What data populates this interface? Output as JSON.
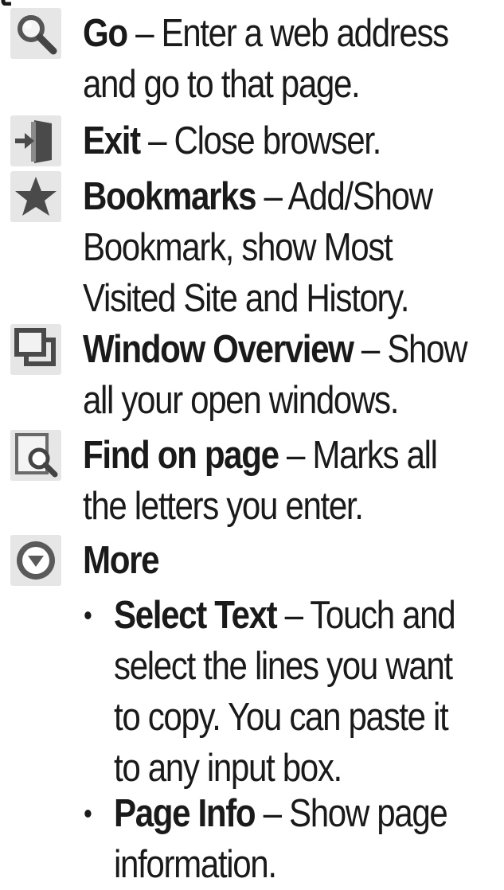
{
  "items": [
    {
      "icon": "search-icon",
      "title": "Go",
      "lines": [
        "– Enter a web address",
        "and go to that page."
      ]
    },
    {
      "icon": "exit-door-icon",
      "title": "Exit",
      "lines": [
        "– Close browser."
      ]
    },
    {
      "icon": "star-icon",
      "title": "Bookmarks",
      "lines": [
        "– Add/Show",
        "Bookmark, show Most",
        "Visited Site and History."
      ]
    },
    {
      "icon": "window-overview-icon",
      "title": "Window Overview",
      "lines": [
        "– Show",
        "all your open windows."
      ]
    },
    {
      "icon": "find-on-page-icon",
      "title": "Find on page",
      "lines": [
        "– Marks all",
        "the letters you enter."
      ]
    },
    {
      "icon": "more-chevron-icon",
      "title": "More",
      "lines": []
    }
  ],
  "more_subitems": [
    {
      "title": "Select Text",
      "lines": [
        "– Touch and",
        "select the lines you want",
        "to copy. You can paste it",
        "to any input box."
      ]
    },
    {
      "title": "Page Info",
      "lines": [
        "– Show page",
        "information."
      ]
    }
  ]
}
